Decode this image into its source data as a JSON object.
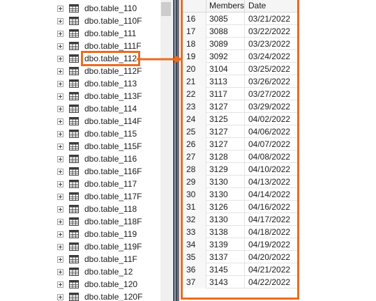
{
  "tree": {
    "items": [
      {
        "label": "dbo.table_110"
      },
      {
        "label": "dbo.table_110F"
      },
      {
        "label": "dbo.table_111"
      },
      {
        "label": "dbo.table_111F"
      },
      {
        "label": "dbo.table_112",
        "highlighted": true
      },
      {
        "label": "dbo.table_112F"
      },
      {
        "label": "dbo.table_113"
      },
      {
        "label": "dbo.table_113F"
      },
      {
        "label": "dbo.table_114"
      },
      {
        "label": "dbo.table_114F"
      },
      {
        "label": "dbo.table_115"
      },
      {
        "label": "dbo.table_115F"
      },
      {
        "label": "dbo.table_116"
      },
      {
        "label": "dbo.table_116F"
      },
      {
        "label": "dbo.table_117"
      },
      {
        "label": "dbo.table_117F"
      },
      {
        "label": "dbo.table_118"
      },
      {
        "label": "dbo.table_118F"
      },
      {
        "label": "dbo.table_119"
      },
      {
        "label": "dbo.table_119F"
      },
      {
        "label": "dbo.table_11F"
      },
      {
        "label": "dbo.table_12"
      },
      {
        "label": "dbo.table_120"
      },
      {
        "label": "dbo.table_120F"
      }
    ]
  },
  "grid": {
    "headers": {
      "members": "Members",
      "date": "Date"
    },
    "rows": [
      {
        "num": "16",
        "members": "3085",
        "date": "03/21/2022"
      },
      {
        "num": "17",
        "members": "3088",
        "date": "03/22/2022"
      },
      {
        "num": "18",
        "members": "3089",
        "date": "03/23/2022"
      },
      {
        "num": "19",
        "members": "3092",
        "date": "03/24/2022"
      },
      {
        "num": "20",
        "members": "3104",
        "date": "03/25/2022"
      },
      {
        "num": "21",
        "members": "3113",
        "date": "03/26/2022"
      },
      {
        "num": "22",
        "members": "3117",
        "date": "03/27/2022"
      },
      {
        "num": "23",
        "members": "3127",
        "date": "03/29/2022"
      },
      {
        "num": "24",
        "members": "3125",
        "date": "04/02/2022"
      },
      {
        "num": "25",
        "members": "3127",
        "date": "04/06/2022"
      },
      {
        "num": "26",
        "members": "3127",
        "date": "04/07/2022"
      },
      {
        "num": "27",
        "members": "3128",
        "date": "04/08/2022"
      },
      {
        "num": "28",
        "members": "3129",
        "date": "04/10/2022"
      },
      {
        "num": "29",
        "members": "3130",
        "date": "04/13/2022"
      },
      {
        "num": "30",
        "members": "3130",
        "date": "04/14/2022"
      },
      {
        "num": "31",
        "members": "3126",
        "date": "04/16/2022"
      },
      {
        "num": "32",
        "members": "3130",
        "date": "04/17/2022"
      },
      {
        "num": "33",
        "members": "3138",
        "date": "04/18/2022"
      },
      {
        "num": "34",
        "members": "3139",
        "date": "04/19/2022"
      },
      {
        "num": "35",
        "members": "3137",
        "date": "04/20/2022"
      },
      {
        "num": "36",
        "members": "3145",
        "date": "04/21/2022"
      },
      {
        "num": "37",
        "members": "3143",
        "date": "04/22/2022"
      }
    ]
  },
  "colors": {
    "highlight": "#ee6a1d",
    "icon": "table-icon",
    "expander_icon": "plus-expander-icon",
    "arrow_icon": "arrow-right-icon"
  }
}
